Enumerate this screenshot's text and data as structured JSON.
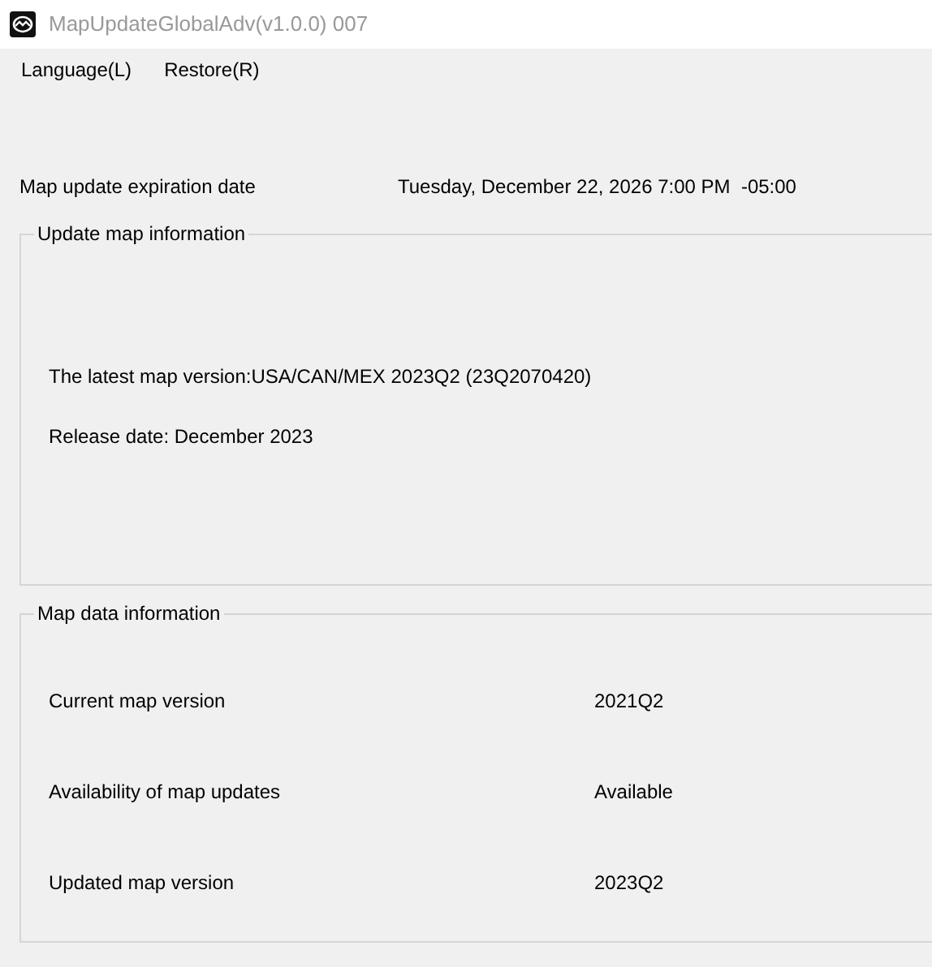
{
  "window": {
    "title": "MapUpdateGlobalAdv(v1.0.0) 007"
  },
  "menu": [
    "Language(L)",
    "Restore(R)"
  ],
  "expiration": {
    "label": "Map update expiration date",
    "value": "Tuesday, December 22, 2026 7:00 PM  -05:00"
  },
  "update_map_information": {
    "title": "Update map information",
    "lines": [
      "The latest map version:USA/CAN/MEX 2023Q2 (23Q2070420)",
      "Release date: December 2023"
    ]
  },
  "map_data_information": {
    "title": "Map data information",
    "rows": [
      {
        "label": "Current map version",
        "value": "2021Q2"
      },
      {
        "label": "Availability of map updates",
        "value": "Available"
      },
      {
        "label": "Updated map version",
        "value": "2023Q2"
      }
    ]
  }
}
